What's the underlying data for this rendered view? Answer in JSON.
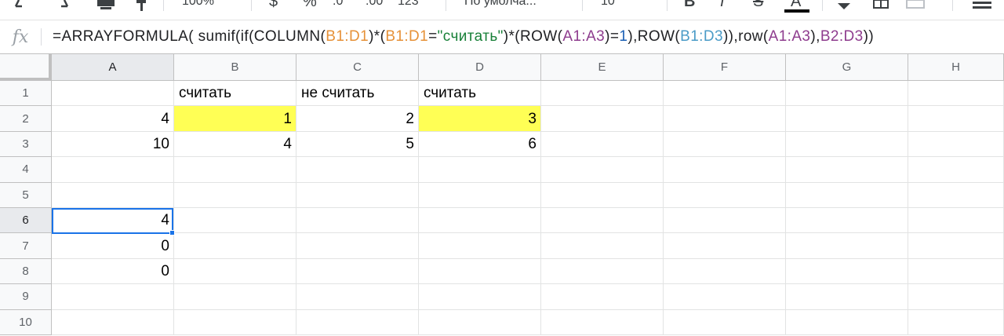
{
  "toolbar": {
    "zoom": "100%",
    "currency": "$",
    "percent": "%",
    "decimal_decrease": ".0",
    "decimal_increase": ".00",
    "more_formats": "123",
    "font_name": "По умолча...",
    "font_size": "10",
    "bold": "B",
    "italic": "I",
    "strikethrough": "S",
    "text_color": "A",
    "icons": [
      "undo-icon",
      "redo-icon",
      "print-icon",
      "paint-format-icon",
      "fill-color-icon",
      "borders-icon",
      "merge-cells-icon",
      "align-icon"
    ]
  },
  "formula_bar": {
    "fx_label": "fx",
    "segments": [
      {
        "text": "=ARRAYFORMULA( sumif(if(COLUMN(",
        "color": "fn"
      },
      {
        "text": "B1:D1",
        "color": "orange"
      },
      {
        "text": ")*(",
        "color": "fn"
      },
      {
        "text": "B1:D1",
        "color": "orange"
      },
      {
        "text": "=",
        "color": "fn"
      },
      {
        "text": "\"считать\"",
        "color": "green"
      },
      {
        "text": ")*(ROW(",
        "color": "fn"
      },
      {
        "text": "A1:A3",
        "color": "purple"
      },
      {
        "text": ")=",
        "color": "fn"
      },
      {
        "text": "1",
        "color": "num"
      },
      {
        "text": "),ROW(",
        "color": "fn"
      },
      {
        "text": "B1:D3",
        "color": "blue"
      },
      {
        "text": ")),row(",
        "color": "fn"
      },
      {
        "text": "A1:A3",
        "color": "purple"
      },
      {
        "text": "),",
        "color": "fn"
      },
      {
        "text": "B2:D3",
        "color": "purple"
      },
      {
        "text": "))",
        "color": "fn"
      }
    ]
  },
  "sheet": {
    "columns": [
      "A",
      "B",
      "C",
      "D",
      "E",
      "F",
      "G",
      "H"
    ],
    "rows": [
      "1",
      "2",
      "3",
      "4",
      "5",
      "6",
      "7",
      "8",
      "9",
      "10"
    ],
    "active_row": "6",
    "active_col": "A",
    "highlight_color": "#ffff55",
    "selection_color": "#1a73e8",
    "cells": [
      {
        "ref": "B1",
        "value": "считать",
        "align": "left"
      },
      {
        "ref": "C1",
        "value": "не считать",
        "align": "left"
      },
      {
        "ref": "D1",
        "value": "считать",
        "align": "left"
      },
      {
        "ref": "A2",
        "value": "4",
        "align": "right"
      },
      {
        "ref": "B2",
        "value": "1",
        "align": "right",
        "highlight": true
      },
      {
        "ref": "C2",
        "value": "2",
        "align": "right"
      },
      {
        "ref": "D2",
        "value": "3",
        "align": "right",
        "highlight": true
      },
      {
        "ref": "A3",
        "value": "10",
        "align": "right"
      },
      {
        "ref": "B3",
        "value": "4",
        "align": "right"
      },
      {
        "ref": "C3",
        "value": "5",
        "align": "right"
      },
      {
        "ref": "D3",
        "value": "6",
        "align": "right"
      },
      {
        "ref": "A6",
        "value": "4",
        "align": "right"
      },
      {
        "ref": "A7",
        "value": "0",
        "align": "right"
      },
      {
        "ref": "A8",
        "value": "0",
        "align": "right"
      }
    ]
  }
}
